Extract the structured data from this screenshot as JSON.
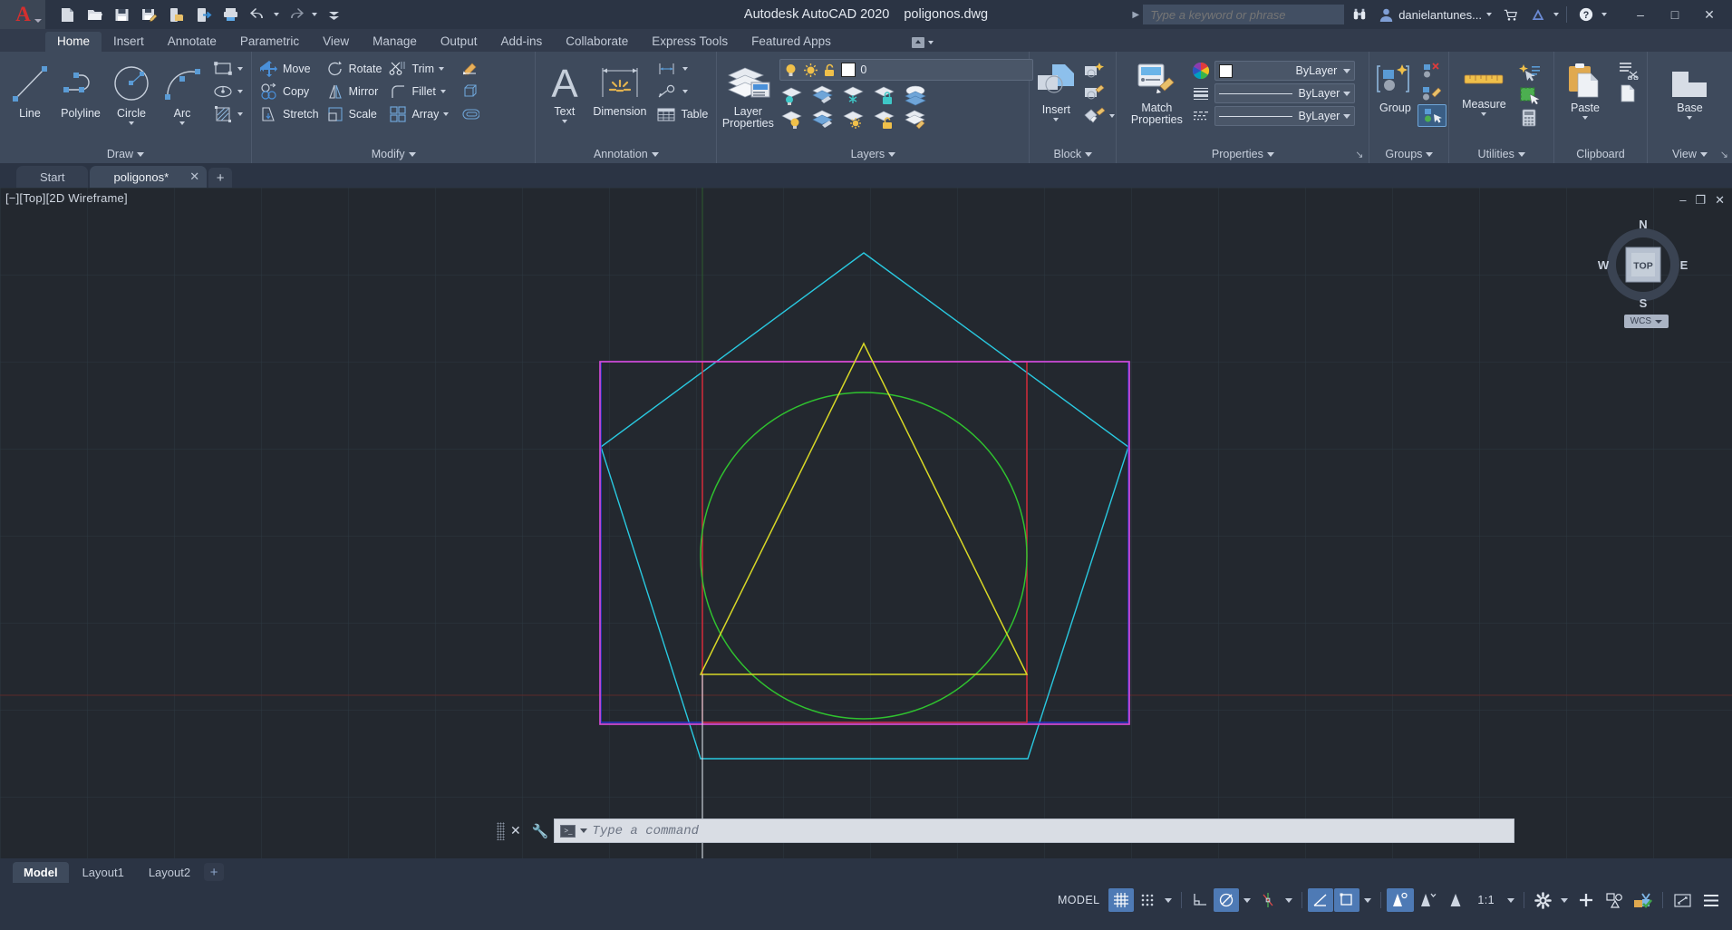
{
  "titlebar": {
    "app_name": "Autodesk AutoCAD 2020",
    "file_name": "poligonos.dwg",
    "quick_access": [
      {
        "name": "new-icon",
        "label": "New"
      },
      {
        "name": "open-icon",
        "label": "Open"
      },
      {
        "name": "save-icon",
        "label": "Save"
      },
      {
        "name": "save-as-icon",
        "label": "Save As"
      },
      {
        "name": "web-mobile-icon",
        "label": "Save to Web & Mobile"
      },
      {
        "name": "open-web-mobile-icon",
        "label": "Open from Web & Mobile"
      },
      {
        "name": "plot-icon",
        "label": "Plot"
      },
      {
        "name": "undo-icon",
        "label": "Undo"
      },
      {
        "name": "redo-icon",
        "label": "Redo"
      },
      {
        "name": "qat-customize-icon",
        "label": "Customize"
      }
    ],
    "search_placeholder": "Type a keyword or phrase",
    "user_name": "danielantunes...",
    "buttons": [
      "minimize",
      "maximize",
      "close"
    ]
  },
  "ribbon": {
    "tabs": [
      "Home",
      "Insert",
      "Annotate",
      "Parametric",
      "View",
      "Manage",
      "Output",
      "Add-ins",
      "Collaborate",
      "Express Tools",
      "Featured Apps"
    ],
    "active_tab": "Home",
    "panels": {
      "draw": {
        "title": "Draw",
        "big": [
          "Line",
          "Polyline",
          "Circle",
          "Arc"
        ],
        "small_icons": [
          "rectangle-icon",
          "ellipse-icon",
          "hatch-icon"
        ]
      },
      "modify": {
        "title": "Modify",
        "col1": [
          "Move",
          "Copy",
          "Stretch"
        ],
        "col2": [
          "Rotate",
          "Mirror",
          "Scale"
        ],
        "col3": [
          "Trim",
          "Fillet",
          "Array"
        ],
        "col4_icons": [
          "erase-icon",
          "explode-icon",
          "offset-icon"
        ]
      },
      "annotation": {
        "title": "Annotation",
        "big": [
          "Text",
          "Dimension"
        ],
        "small": [
          "Linear",
          "Leader",
          "Table"
        ]
      },
      "layers": {
        "title": "Layers",
        "big": "Layer Properties",
        "current_layer": "0",
        "row1_icons": [
          "layer-on-icon",
          "layer-sun-icon",
          "layer-unlock-icon"
        ],
        "grid_icons": [
          [
            "layer-isolate-icon",
            "layer-unisolate-icon",
            "layer-freeze-icon",
            "layer-lock-icon",
            "layer-make-current-icon"
          ],
          [
            "layer-off-icon",
            "layer-turn-all-on-icon",
            "layer-thaw-icon",
            "layer-unlock2-icon",
            "layer-match-icon"
          ]
        ]
      },
      "block": {
        "title": "Block",
        "big": "Insert",
        "small_icons": [
          "create-block-icon",
          "edit-block-icon",
          "block-attribute-icon"
        ]
      },
      "properties": {
        "title": "Properties",
        "big": "Match Properties",
        "color_value": "ByLayer",
        "lineweight_value": "ByLayer",
        "linetype_value": "ByLayer",
        "icons": [
          "color-wheel-icon",
          "lineweight-icon",
          "linetype-icon"
        ]
      },
      "groups": {
        "title": "Groups",
        "big": "Group",
        "small_icons": [
          "ungroup-icon",
          "group-edit-icon",
          "group-selection-icon"
        ]
      },
      "utilities": {
        "title": "Utilities",
        "big": "Measure",
        "small_icons": [
          "quick-select-icon",
          "quick-calc-select-icon",
          "calculator-icon"
        ]
      },
      "clipboard": {
        "title": "Clipboard",
        "big": "Paste",
        "small_icons": [
          "cut-icon",
          "copy-icon"
        ]
      },
      "view": {
        "title": "View",
        "big": "Base"
      }
    }
  },
  "doc_tabs": {
    "tabs": [
      {
        "label": "Start",
        "active": false,
        "closable": false
      },
      {
        "label": "poligonos*",
        "active": true,
        "closable": true
      }
    ],
    "add_label": "+"
  },
  "viewport": {
    "label": "[−][Top][2D Wireframe]",
    "viewcube": {
      "top": "TOP",
      "n": "N",
      "e": "E",
      "s": "S",
      "w": "W"
    },
    "ucs": "WCS",
    "controls": [
      "minimize-viewport-icon",
      "restore-viewport-icon",
      "close-viewport-icon"
    ],
    "background": "#23282f",
    "grid_color": "#31414b",
    "shapes": [
      {
        "name": "cyan-pentagon",
        "color": "#29c9e0"
      },
      {
        "name": "magenta-rectangle",
        "color": "#d24ad2"
      },
      {
        "name": "green-circle",
        "color": "#2fc22f"
      },
      {
        "name": "yellow-triangle",
        "color": "#d8d826"
      },
      {
        "name": "red-rectangle",
        "color": "#e02b3b"
      },
      {
        "name": "blue-rectangle",
        "color": "#2c35d6"
      }
    ]
  },
  "command_line": {
    "placeholder": "Type a command",
    "close_label": "✕",
    "customize_label": "wrench-icon"
  },
  "layout_tabs": {
    "tabs": [
      "Model",
      "Layout1",
      "Layout2"
    ],
    "active": "Model",
    "add_label": "+"
  },
  "status_bar": {
    "space_label": "MODEL",
    "scale_label": "1:1",
    "items": [
      {
        "name": "model-space-button",
        "label": "MODEL",
        "on": false
      },
      {
        "name": "grid-display-button",
        "icon": "grid-icon",
        "on": true
      },
      {
        "name": "snap-mode-button",
        "icon": "snap-icon",
        "on": false
      },
      {
        "name": "ortho-mode-button",
        "icon": "ortho-icon",
        "on": false
      },
      {
        "name": "polar-tracking-button",
        "icon": "polar-icon",
        "on": true
      },
      {
        "name": "object-snap-tracking-button",
        "icon": "osnap-tracking-icon",
        "on": false
      },
      {
        "name": "object-snap-button",
        "icon": "osnap-icon",
        "on": true
      },
      {
        "name": "lineweight-button",
        "icon": "lineweight-display-icon",
        "on": true
      },
      {
        "name": "transparency-button",
        "icon": "transparency-icon",
        "on": true
      },
      {
        "name": "selection-cycling-button",
        "icon": "selection-cycling-icon",
        "on": false
      },
      {
        "name": "annotation-visibility-button",
        "icon": "annotation-visibility-icon",
        "on": false
      },
      {
        "name": "annotation-scale-button",
        "label": "1:1",
        "on": false
      },
      {
        "name": "workspace-switching-button",
        "icon": "gear-icon",
        "on": false
      },
      {
        "name": "hardware-acceleration-button",
        "icon": "plus-icon",
        "on": false
      },
      {
        "name": "isolate-objects-button",
        "icon": "isolate-objects-icon",
        "on": false
      },
      {
        "name": "clean-screen-button",
        "icon": "clean-screen-icon",
        "on": false
      },
      {
        "name": "fullscreen-button",
        "icon": "fullscreen-icon",
        "on": false
      },
      {
        "name": "customization-button",
        "icon": "hamburger-icon",
        "on": false
      }
    ]
  }
}
